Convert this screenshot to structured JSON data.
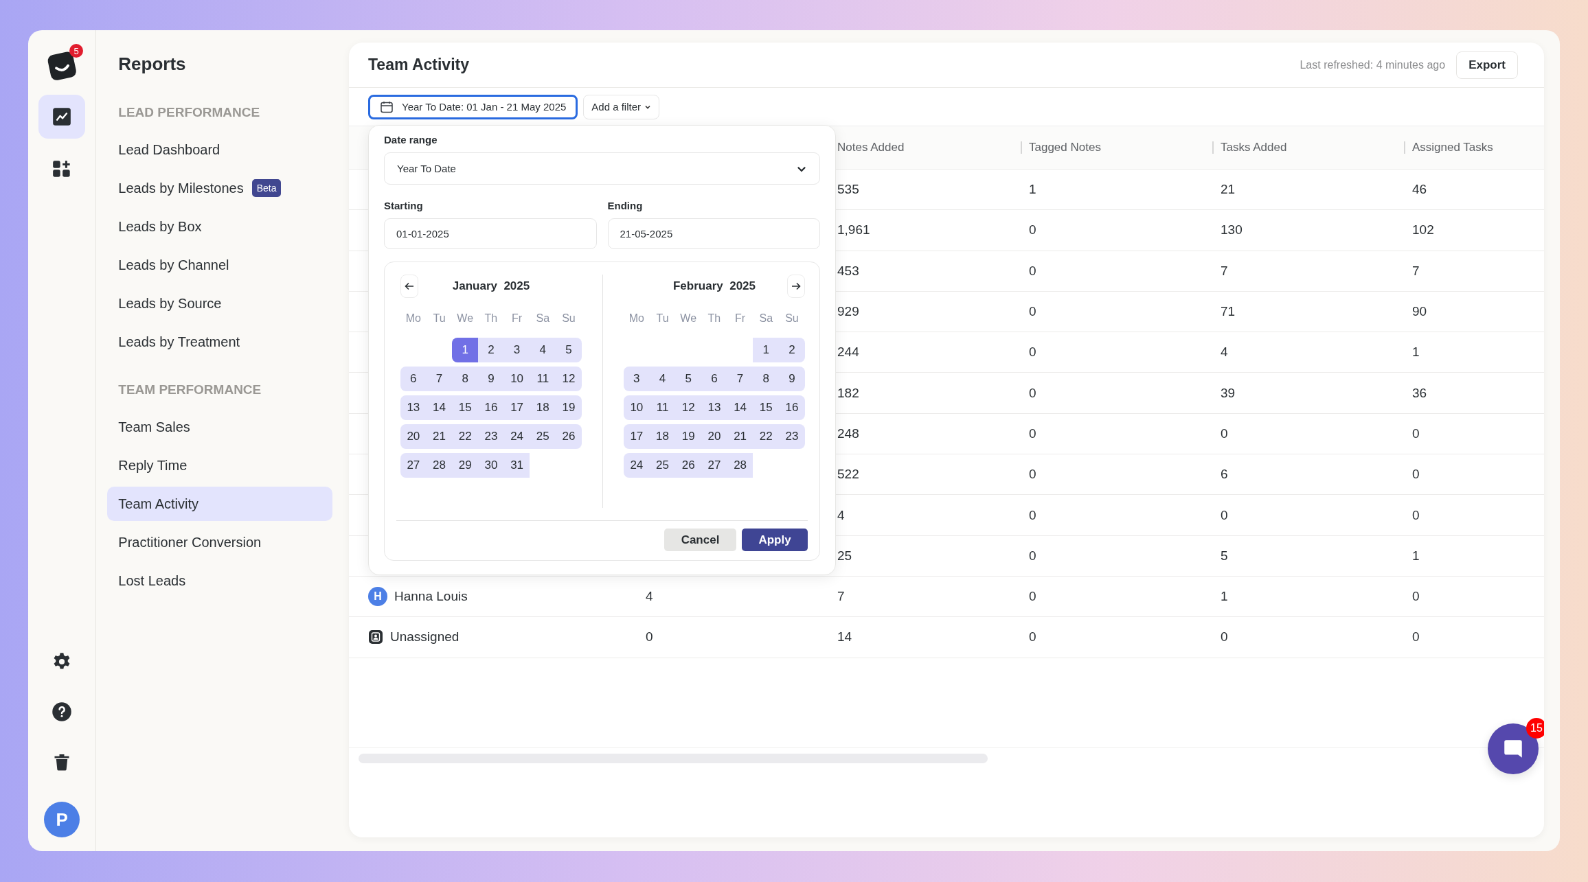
{
  "rail": {
    "logo_badge": "5",
    "items": [
      {
        "kind": "chart",
        "selected": true
      },
      {
        "kind": "apps",
        "selected": false
      }
    ],
    "bottom": [
      {
        "kind": "settings"
      },
      {
        "kind": "help"
      },
      {
        "kind": "trash"
      }
    ],
    "avatar": "P"
  },
  "sidebar": {
    "title": "Reports",
    "sections": [
      {
        "title": "LEAD PERFORMANCE",
        "items": [
          {
            "label": "Lead Dashboard",
            "selected": false
          },
          {
            "label": "Leads by Milestones",
            "selected": false,
            "badge": "Beta"
          },
          {
            "label": "Leads by Box",
            "selected": false
          },
          {
            "label": "Leads by Channel",
            "selected": false
          },
          {
            "label": "Leads by Source",
            "selected": false
          },
          {
            "label": "Leads by Treatment",
            "selected": false
          }
        ]
      },
      {
        "title": "TEAM PERFORMANCE",
        "items": [
          {
            "label": "Team Sales",
            "selected": false
          },
          {
            "label": "Reply Time",
            "selected": false
          },
          {
            "label": "Team Activity",
            "selected": true
          },
          {
            "label": "Practitioner Conversion",
            "selected": false
          },
          {
            "label": "Lost Leads",
            "selected": false
          }
        ]
      }
    ]
  },
  "main": {
    "title": "Team Activity",
    "last_refreshed": "Last refreshed: 4 minutes ago",
    "export_button": "Export",
    "date_filter": {
      "label": "Year To Date: 01 Jan - 21 May 2025",
      "active": true
    },
    "add_filter": "Add a filter"
  },
  "table": {
    "columns": [
      "Notes Added",
      "Tagged Notes",
      "Tasks Added",
      "Assigned Tasks"
    ],
    "rows": [
      {
        "notes_added": "535",
        "tagged_notes": "1",
        "tasks_added": "21",
        "assigned_tasks": "46"
      },
      {
        "notes_added": "1,961",
        "tagged_notes": "0",
        "tasks_added": "130",
        "assigned_tasks": "102"
      },
      {
        "notes_added": "453",
        "tagged_notes": "0",
        "tasks_added": "7",
        "assigned_tasks": "7"
      },
      {
        "notes_added": "929",
        "tagged_notes": "0",
        "tasks_added": "71",
        "assigned_tasks": "90"
      },
      {
        "notes_added": "244",
        "tagged_notes": "0",
        "tasks_added": "4",
        "assigned_tasks": "1"
      },
      {
        "notes_added": "182",
        "tagged_notes": "0",
        "tasks_added": "39",
        "assigned_tasks": "36"
      },
      {
        "notes_added": "248",
        "tagged_notes": "0",
        "tasks_added": "0",
        "assigned_tasks": "0"
      },
      {
        "notes_added": "522",
        "tagged_notes": "0",
        "tasks_added": "6",
        "assigned_tasks": "0"
      },
      {
        "notes_added": "4",
        "tagged_notes": "0",
        "tasks_added": "0",
        "assigned_tasks": "0"
      },
      {
        "notes_added": "25",
        "tagged_notes": "0",
        "tasks_added": "5",
        "assigned_tasks": "1"
      },
      {
        "avatar": {
          "kind": "initial",
          "letter": "H"
        },
        "name": "Hanna Louis",
        "column_2": "4",
        "notes_added": "7",
        "tagged_notes": "0",
        "tasks_added": "1",
        "assigned_tasks": "0"
      },
      {
        "avatar": {
          "kind": "unassigned"
        },
        "name": "Unassigned",
        "column_2": "0",
        "notes_added": "14",
        "tagged_notes": "0",
        "tasks_added": "0",
        "assigned_tasks": "0"
      }
    ]
  },
  "date_popup": {
    "range_label": "Date range",
    "range_value": "Year To Date",
    "starting_label": "Starting",
    "starting_value": "01-01-2025",
    "ending_label": "Ending",
    "ending_value": "21-05-2025",
    "months": [
      {
        "title": "January  2025",
        "weekdays": [
          "Mo",
          "Tu",
          "We",
          "Th",
          "Fr",
          "Sa",
          "Su"
        ],
        "weeks": [
          {
            "kind": "leading",
            "days": [
              {
                "label": "1",
                "selected": true,
                "in_range": true
              },
              {
                "label": "2",
                "selected": false,
                "in_range": true
              },
              {
                "label": "3",
                "selected": false,
                "in_range": true
              },
              {
                "label": "4",
                "selected": false,
                "in_range": true
              },
              {
                "label": "5",
                "selected": false,
                "in_range": true
              }
            ]
          },
          {
            "kind": "full",
            "days": [
              {
                "label": "6",
                "selected": false,
                "in_range": true
              },
              {
                "label": "7",
                "selected": false,
                "in_range": true
              },
              {
                "label": "8",
                "selected": false,
                "in_range": true
              },
              {
                "label": "9",
                "selected": false,
                "in_range": true
              },
              {
                "label": "10",
                "selected": false,
                "in_range": true
              },
              {
                "label": "11",
                "selected": false,
                "in_range": true
              },
              {
                "label": "12",
                "selected": false,
                "in_range": true
              }
            ]
          },
          {
            "kind": "full",
            "days": [
              {
                "label": "13",
                "selected": false,
                "in_range": true
              },
              {
                "label": "14",
                "selected": false,
                "in_range": true
              },
              {
                "label": "15",
                "selected": false,
                "in_range": true
              },
              {
                "label": "16",
                "selected": false,
                "in_range": true
              },
              {
                "label": "17",
                "selected": false,
                "in_range": true
              },
              {
                "label": "18",
                "selected": false,
                "in_range": true
              },
              {
                "label": "19",
                "selected": false,
                "in_range": true
              }
            ]
          },
          {
            "kind": "full",
            "days": [
              {
                "label": "20",
                "selected": false,
                "in_range": true
              },
              {
                "label": "21",
                "selected": false,
                "in_range": true
              },
              {
                "label": "22",
                "selected": false,
                "in_range": true
              },
              {
                "label": "23",
                "selected": false,
                "in_range": true
              },
              {
                "label": "24",
                "selected": false,
                "in_range": true
              },
              {
                "label": "25",
                "selected": false,
                "in_range": true
              },
              {
                "label": "26",
                "selected": false,
                "in_range": true
              }
            ]
          },
          {
            "kind": "trailing",
            "days": [
              {
                "label": "27",
                "selected": false,
                "in_range": true
              },
              {
                "label": "28",
                "selected": false,
                "in_range": true
              },
              {
                "label": "29",
                "selected": false,
                "in_range": true
              },
              {
                "label": "30",
                "selected": false,
                "in_range": true
              },
              {
                "label": "31",
                "selected": false,
                "in_range": true
              }
            ]
          }
        ]
      },
      {
        "title": "February  2025",
        "weekdays": [
          "Mo",
          "Tu",
          "We",
          "Th",
          "Fr",
          "Sa",
          "Su"
        ],
        "weeks": [
          {
            "kind": "leading",
            "days": [
              {
                "label": "1",
                "selected": false,
                "in_range": true
              },
              {
                "label": "2",
                "selected": false,
                "in_range": true
              }
            ]
          },
          {
            "kind": "full",
            "days": [
              {
                "label": "3",
                "selected": false,
                "in_range": true
              },
              {
                "label": "4",
                "selected": false,
                "in_range": true
              },
              {
                "label": "5",
                "selected": false,
                "in_range": true
              },
              {
                "label": "6",
                "selected": false,
                "in_range": true
              },
              {
                "label": "7",
                "selected": false,
                "in_range": true
              },
              {
                "label": "8",
                "selected": false,
                "in_range": true
              },
              {
                "label": "9",
                "selected": false,
                "in_range": true
              }
            ]
          },
          {
            "kind": "full",
            "days": [
              {
                "label": "10",
                "selected": false,
                "in_range": true
              },
              {
                "label": "11",
                "selected": false,
                "in_range": true
              },
              {
                "label": "12",
                "selected": false,
                "in_range": true
              },
              {
                "label": "13",
                "selected": false,
                "in_range": true
              },
              {
                "label": "14",
                "selected": false,
                "in_range": true
              },
              {
                "label": "15",
                "selected": false,
                "in_range": true
              },
              {
                "label": "16",
                "selected": false,
                "in_range": true
              }
            ]
          },
          {
            "kind": "full",
            "days": [
              {
                "label": "17",
                "selected": false,
                "in_range": true
              },
              {
                "label": "18",
                "selected": false,
                "in_range": true
              },
              {
                "label": "19",
                "selected": false,
                "in_range": true
              },
              {
                "label": "20",
                "selected": false,
                "in_range": true
              },
              {
                "label": "21",
                "selected": false,
                "in_range": true
              },
              {
                "label": "22",
                "selected": false,
                "in_range": true
              },
              {
                "label": "23",
                "selected": false,
                "in_range": true
              }
            ]
          },
          {
            "kind": "trailing",
            "days": [
              {
                "label": "24",
                "selected": false,
                "in_range": true
              },
              {
                "label": "25",
                "selected": false,
                "in_range": true
              },
              {
                "label": "26",
                "selected": false,
                "in_range": true
              },
              {
                "label": "27",
                "selected": false,
                "in_range": true
              },
              {
                "label": "28",
                "selected": false,
                "in_range": true
              }
            ]
          }
        ]
      }
    ],
    "cancel_button": "Cancel",
    "apply_button": "Apply"
  },
  "chat": {
    "badge": "15"
  }
}
